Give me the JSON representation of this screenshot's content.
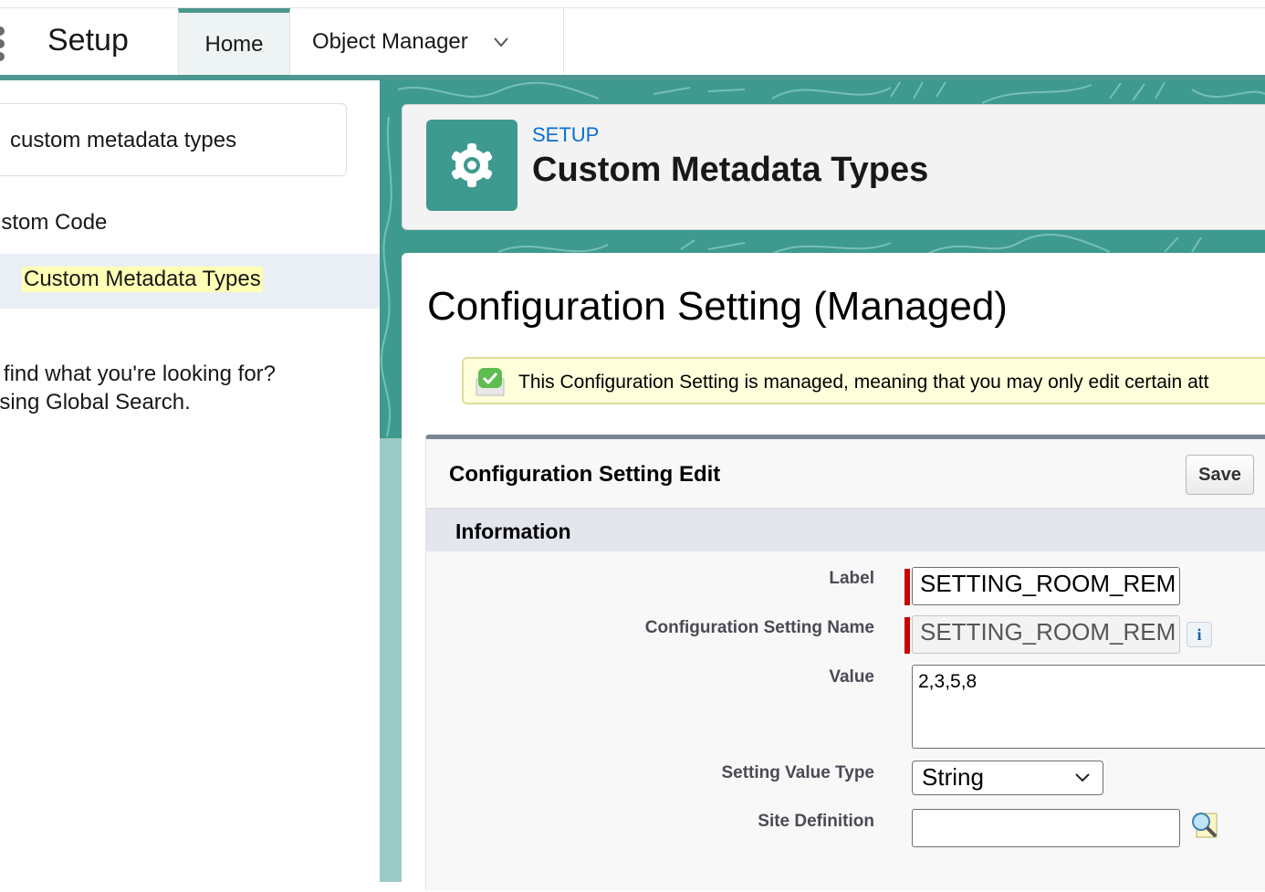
{
  "topbar": {
    "app_title": "Setup",
    "tabs": [
      {
        "label": "Home",
        "active": true
      },
      {
        "label": "Object Manager",
        "has_dropdown": true
      }
    ]
  },
  "sidebar": {
    "search_value": "custom metadata types",
    "group_label": "ustom Code",
    "selected_item": "Custom Metadata Types",
    "help_line1": "'t find what you're looking for?",
    "help_line2": "using Global Search."
  },
  "header": {
    "eyebrow": "SETUP",
    "title": "Custom Metadata Types",
    "icon": "gear-icon"
  },
  "page": {
    "heading": "Configuration Setting (Managed)",
    "message": "This Configuration Setting is managed, meaning that you may only edit certain att",
    "message_icon": "checkmark-icon"
  },
  "edit_block": {
    "title": "Configuration Setting Edit",
    "save_label": "Save",
    "section_title": "Information",
    "fields": {
      "label": {
        "label": "Label",
        "value": "SETTING_ROOM_REM",
        "required": true
      },
      "name": {
        "label": "Configuration Setting Name",
        "value": "SETTING_ROOM_REM",
        "required": true,
        "read_only": true
      },
      "value": {
        "label": "Value",
        "value": "2,3,5,8"
      },
      "value_type": {
        "label": "Setting Value Type",
        "value": "String"
      },
      "site_definition": {
        "label": "Site Definition",
        "value": ""
      }
    }
  },
  "colors": {
    "brand_teal": "#3e9a8f",
    "eyebrow_blue": "#0b6fd0",
    "required_red": "#cc0000",
    "highlight_yellow": "#ffffb5"
  }
}
